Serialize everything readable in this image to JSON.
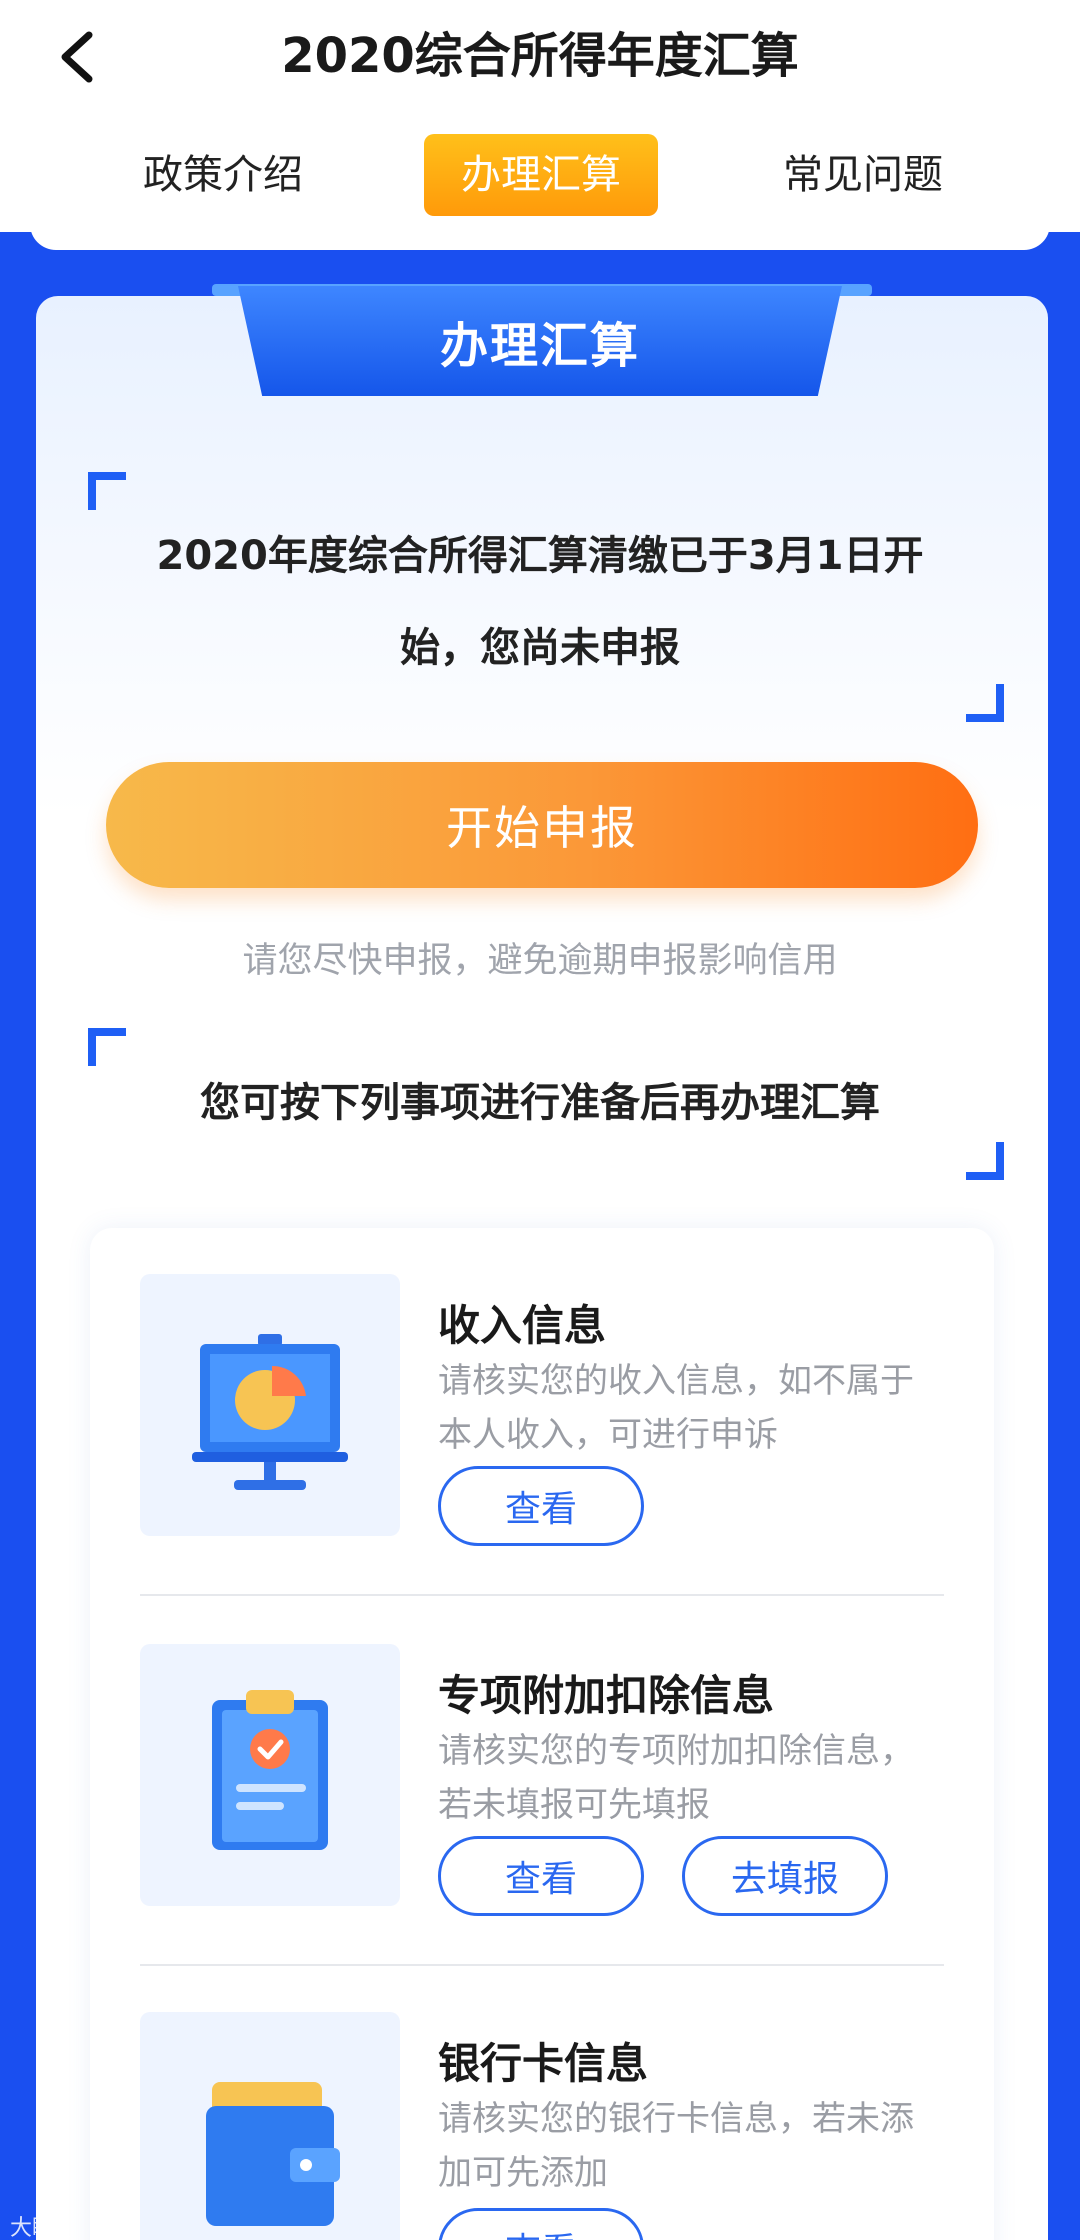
{
  "header": {
    "title": "2020综合所得年度汇算",
    "tabs": [
      {
        "label": "政策介绍"
      },
      {
        "label": "办理汇算"
      },
      {
        "label": "常见问题"
      }
    ]
  },
  "section": {
    "ribbon": "办理汇算",
    "notice_line1": "2020年度综合所得汇算清缴已于3月1日开",
    "notice_line2": "始，您尚未申报",
    "start_button": "开始申报",
    "hint": "请您尽快申报，避免逾期申报影响信用",
    "prep_title": "您可按下列事项进行准备后再办理汇算"
  },
  "items": [
    {
      "title": "收入信息",
      "desc1": "请核实您的收入信息，如不属于",
      "desc2": "本人收入，可进行申诉",
      "btn_view": "查看",
      "icon": "presentation-pie-chart-icon"
    },
    {
      "title": "专项附加扣除信息",
      "desc1": "请核实您的专项附加扣除信息，",
      "desc2": "若未填报可先填报",
      "btn_view": "查看",
      "btn_fill": "去填报",
      "icon": "clipboard-check-icon"
    },
    {
      "title": "银行卡信息",
      "desc1": "请核实您的银行卡信息，若未添",
      "desc2": "加可先添加",
      "btn_view": "查看",
      "icon": "wallet-icon"
    }
  ],
  "colors": {
    "brand_blue": "#1a4ff0",
    "accent_orange": "#ff9a0a",
    "text_muted": "#9a9da4"
  },
  "watermark": "大眼睛"
}
